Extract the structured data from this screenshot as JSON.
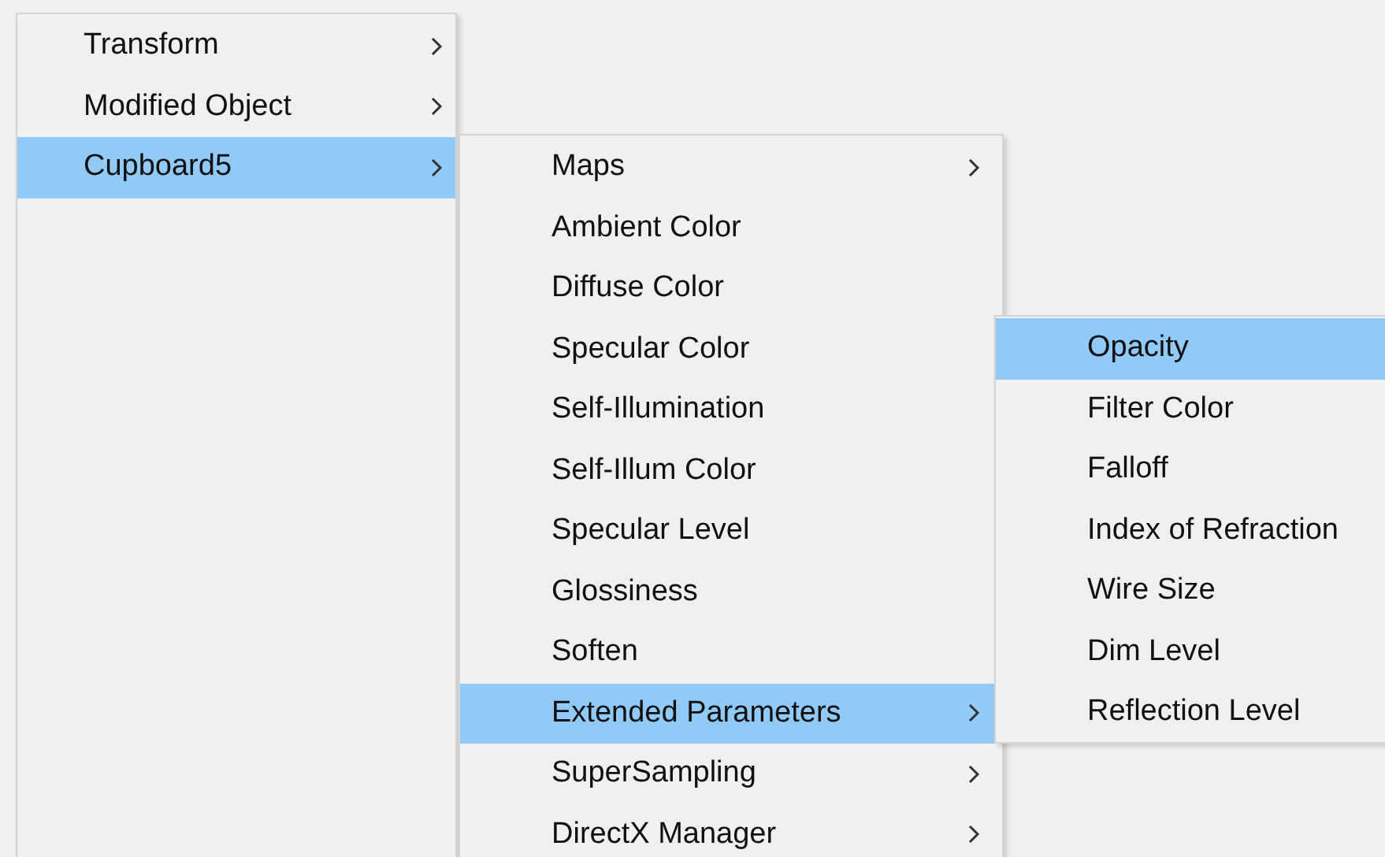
{
  "menus": [
    {
      "items": [
        {
          "label": "Transform",
          "submenu": true,
          "selected": false
        },
        {
          "label": "Modified Object",
          "submenu": true,
          "selected": false
        },
        {
          "label": "Cupboard5",
          "submenu": true,
          "selected": true
        }
      ]
    },
    {
      "items": [
        {
          "label": "Maps",
          "submenu": true,
          "selected": false
        },
        {
          "label": "Ambient Color",
          "submenu": false,
          "selected": false
        },
        {
          "label": "Diffuse Color",
          "submenu": false,
          "selected": false
        },
        {
          "label": "Specular Color",
          "submenu": false,
          "selected": false
        },
        {
          "label": "Self-Illumination",
          "submenu": false,
          "selected": false
        },
        {
          "label": "Self-Illum Color",
          "submenu": false,
          "selected": false
        },
        {
          "label": "Specular Level",
          "submenu": false,
          "selected": false
        },
        {
          "label": "Glossiness",
          "submenu": false,
          "selected": false
        },
        {
          "label": "Soften",
          "submenu": false,
          "selected": false
        },
        {
          "label": "Extended Parameters",
          "submenu": true,
          "selected": true
        },
        {
          "label": "SuperSampling",
          "submenu": true,
          "selected": false
        },
        {
          "label": "DirectX Manager",
          "submenu": true,
          "selected": false
        }
      ]
    },
    {
      "items": [
        {
          "label": "Opacity",
          "submenu": false,
          "selected": true
        },
        {
          "label": "Filter Color",
          "submenu": false,
          "selected": false
        },
        {
          "label": "Falloff",
          "submenu": false,
          "selected": false
        },
        {
          "label": "Index of Refraction",
          "submenu": false,
          "selected": false
        },
        {
          "label": "Wire Size",
          "submenu": false,
          "selected": false
        },
        {
          "label": "Dim Level",
          "submenu": false,
          "selected": false
        },
        {
          "label": "Reflection Level",
          "submenu": false,
          "selected": false
        }
      ]
    }
  ]
}
